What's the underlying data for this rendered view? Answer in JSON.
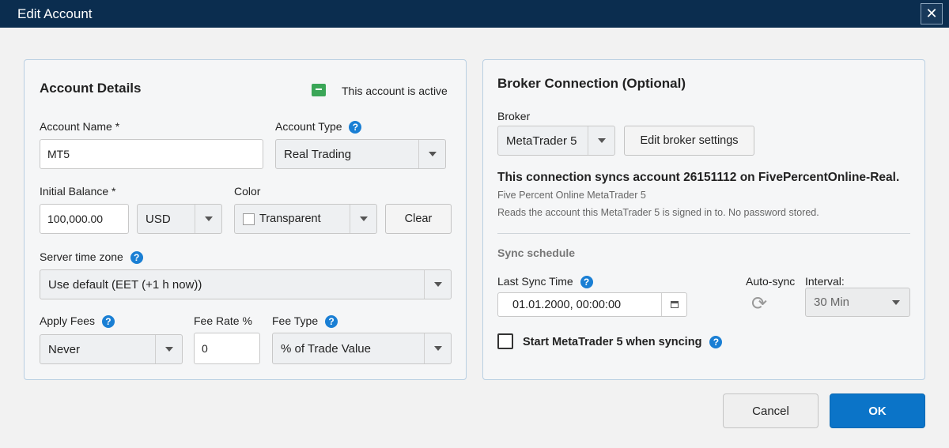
{
  "window": {
    "title": "Edit Account",
    "close_glyph": "✕"
  },
  "account_details": {
    "title": "Account Details",
    "active_text": "This account is active",
    "account_name_label": "Account Name *",
    "account_name_value": "MT5",
    "account_type_label": "Account Type",
    "account_type_value": "Real Trading",
    "initial_balance_label": "Initial Balance *",
    "initial_balance_value": "100,000.00",
    "currency_value": "USD",
    "color_label": "Color",
    "color_value": "Transparent",
    "clear_label": "Clear",
    "server_tz_label": "Server time zone",
    "server_tz_value": "Use default (EET (+1 h now))",
    "apply_fees_label": "Apply Fees",
    "apply_fees_value": "Never",
    "fee_rate_label": "Fee Rate %",
    "fee_rate_value": "0",
    "fee_type_label": "Fee Type",
    "fee_type_value": "% of Trade Value"
  },
  "broker": {
    "title": "Broker Connection (Optional)",
    "broker_label": "Broker",
    "broker_value": "MetaTrader 5",
    "edit_settings_label": "Edit broker settings",
    "sync_headline": "This connection syncs account 26151112 on FivePercentOnline-Real.",
    "sync_sub1": "Five Percent Online MetaTrader 5",
    "sync_sub2": "Reads the account this MetaTrader 5 is signed in to. No password stored.",
    "sync_schedule_label": "Sync schedule",
    "last_sync_label": "Last Sync Time",
    "last_sync_value": "01.01.2000, 00:00:00",
    "auto_sync_label": "Auto-sync",
    "interval_label": "Interval:",
    "interval_value": "30 Min",
    "start_mt_label": "Start MetaTrader 5 when syncing"
  },
  "footer": {
    "cancel_label": "Cancel",
    "ok_label": "OK"
  },
  "colors": {
    "titlebar": "#0b2d4f",
    "accent": "#0b74c8",
    "help": "#1a7fd4",
    "active": "#3aa657"
  },
  "icons": {
    "help": "?",
    "refresh": "⟳",
    "calendar": "calendar-icon"
  }
}
